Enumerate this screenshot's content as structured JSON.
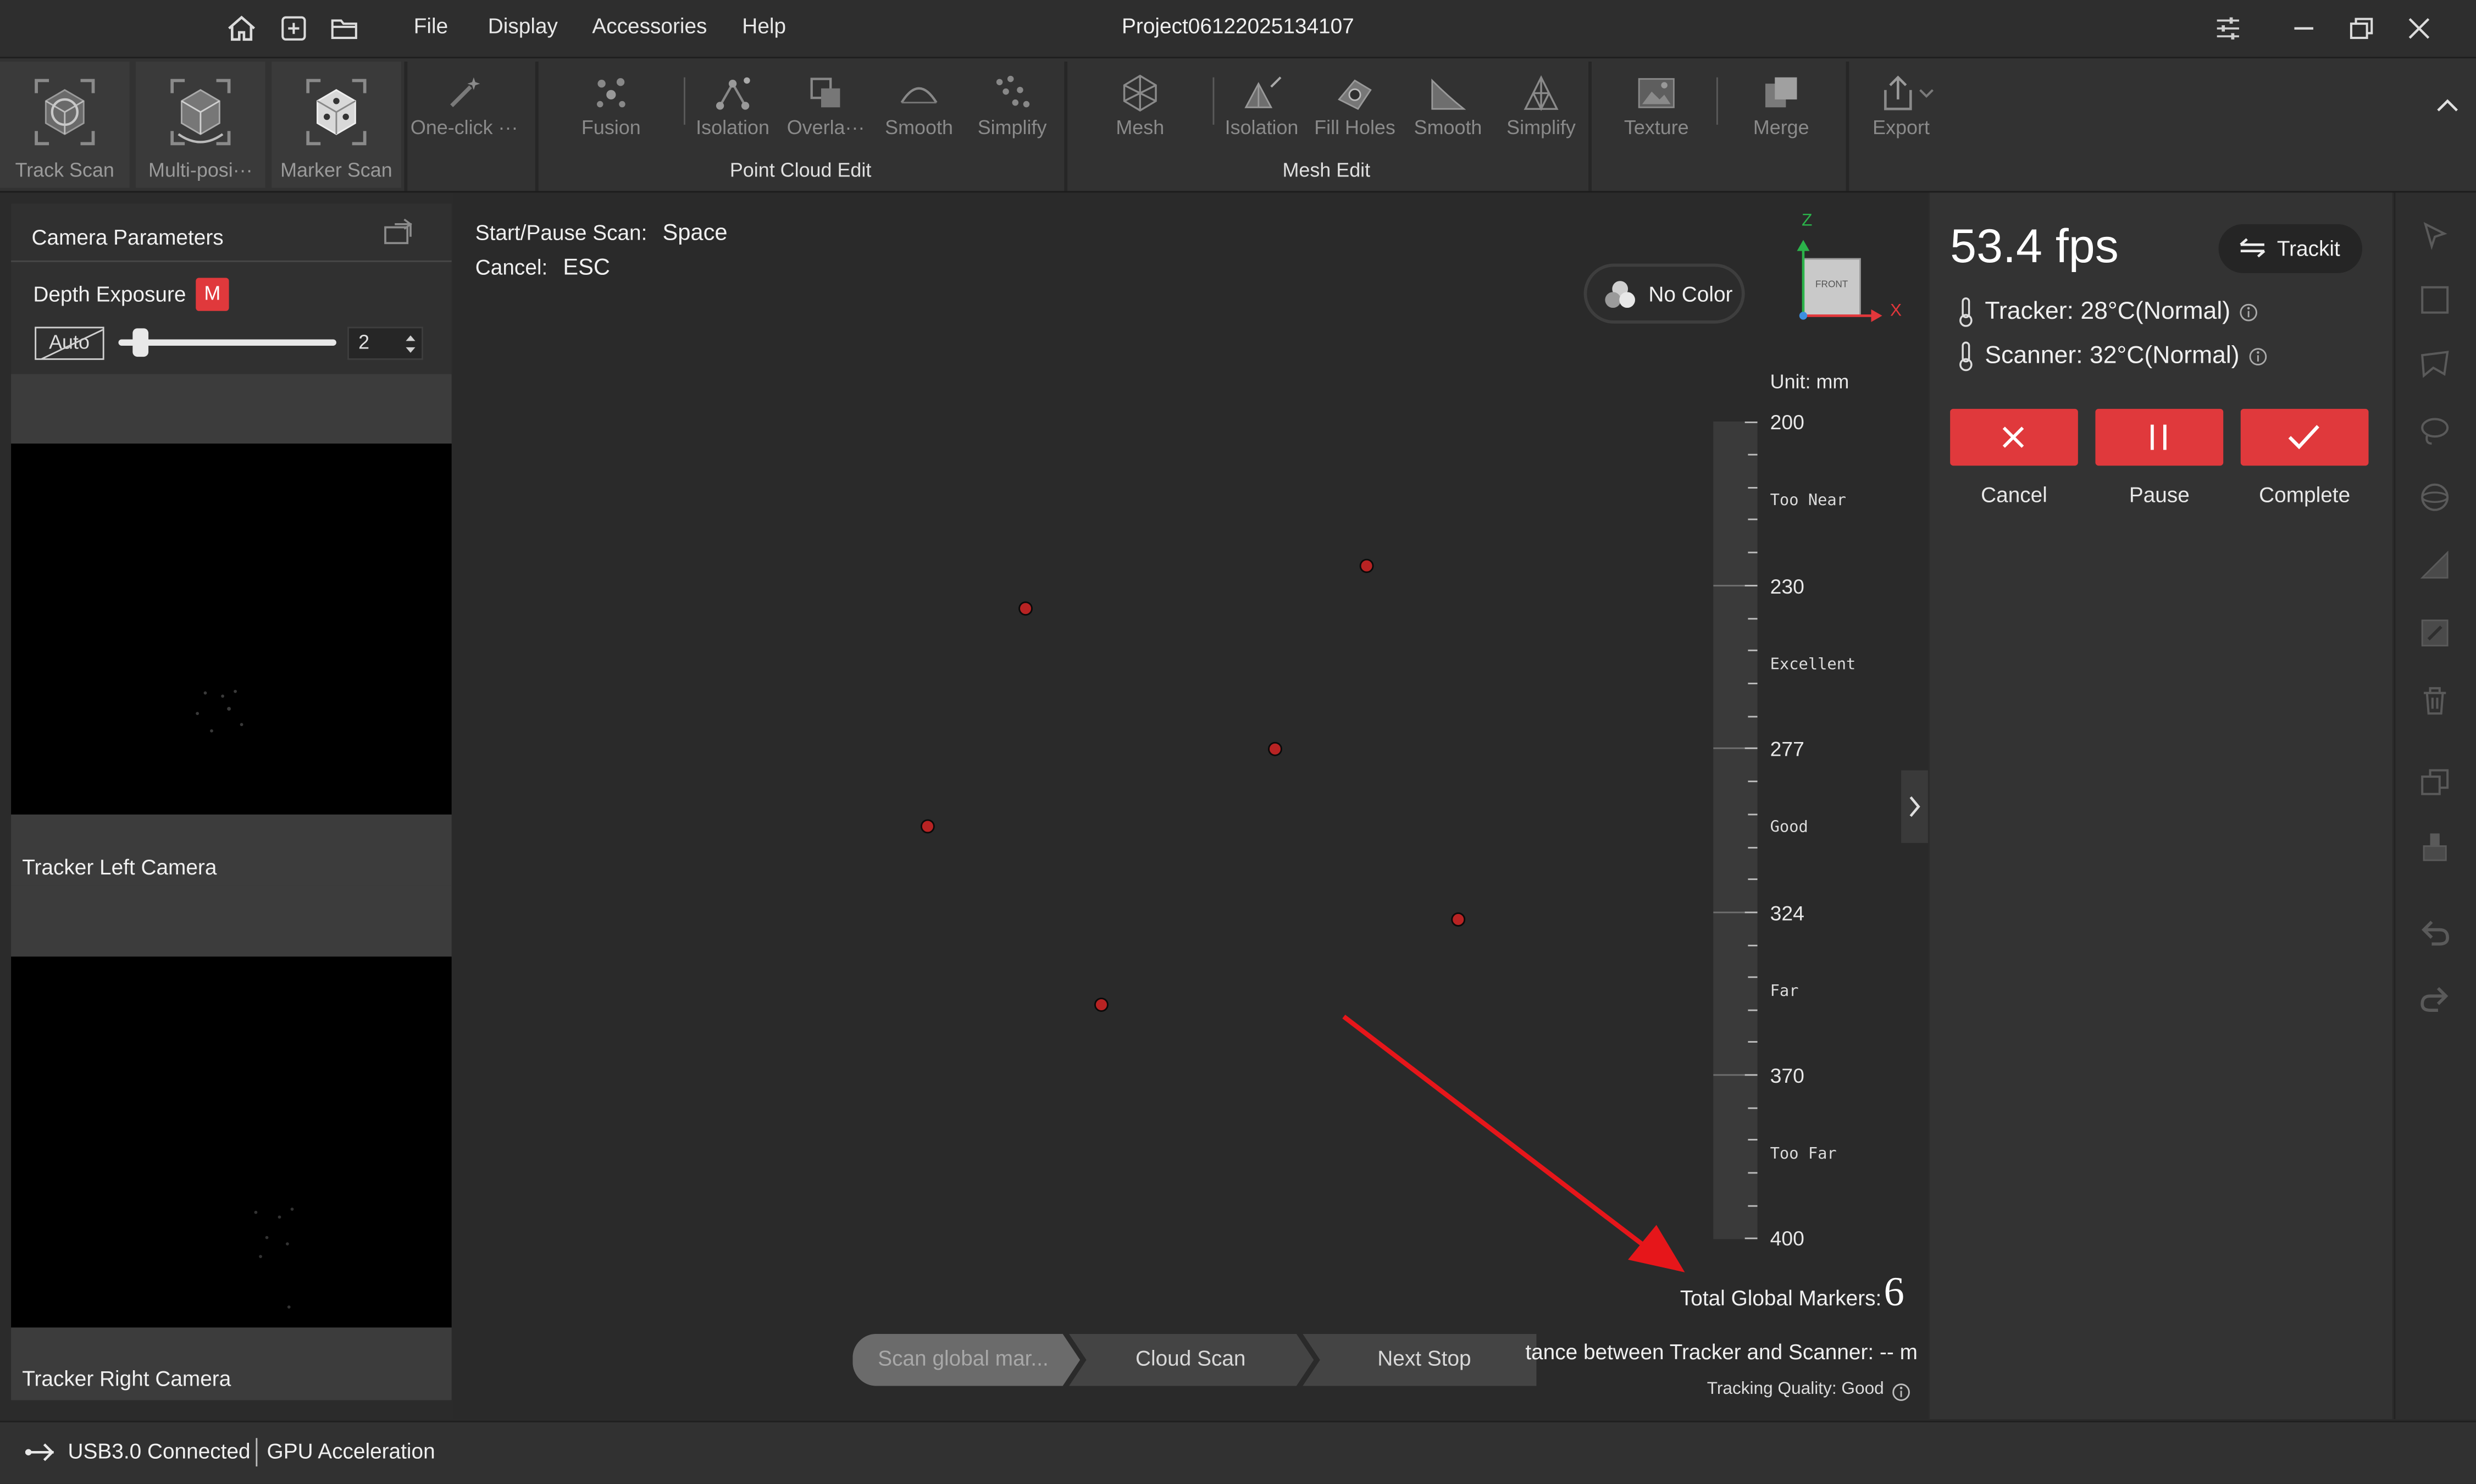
{
  "window": {
    "title": "Project06122025134107",
    "menu": [
      "File",
      "Display",
      "Accessories",
      "Help"
    ]
  },
  "toolbar": {
    "scan_modes": [
      {
        "label": "Track Scan",
        "icon": "track-scan-icon"
      },
      {
        "label": "Multi-posi···",
        "icon": "multi-position-icon"
      },
      {
        "label": "Marker Scan",
        "icon": "marker-scan-icon"
      }
    ],
    "one_click": {
      "label": "One-click ···",
      "icon": "magic-wand-icon"
    },
    "fusion": {
      "label": "Fusion",
      "icon": "fusion-icon"
    },
    "point_cloud_tools": [
      {
        "label": "Isolation",
        "icon": "isolation-icon"
      },
      {
        "label": "Overla···",
        "icon": "overlap-icon"
      },
      {
        "label": "Smooth",
        "icon": "smooth-icon"
      },
      {
        "label": "Simplify",
        "icon": "simplify-icon"
      }
    ],
    "point_cloud_group": "Point Cloud Edit",
    "mesh": {
      "label": "Mesh",
      "icon": "mesh-icon"
    },
    "mesh_tools": [
      {
        "label": "Isolation",
        "icon": "mesh-isolation-icon"
      },
      {
        "label": "Fill Holes",
        "icon": "fill-holes-icon"
      },
      {
        "label": "Smooth",
        "icon": "mesh-smooth-icon"
      },
      {
        "label": "Simplify",
        "icon": "mesh-simplify-icon"
      }
    ],
    "mesh_group": "Mesh Edit",
    "texture": {
      "label": "Texture",
      "icon": "texture-icon"
    },
    "merge": {
      "label": "Merge",
      "icon": "merge-icon"
    },
    "export": {
      "label": "Export",
      "icon": "export-icon"
    }
  },
  "left_panel": {
    "title": "Camera Parameters",
    "depth_exposure_label": "Depth Exposure",
    "mode_badge": "M",
    "auto_label": "Auto",
    "exposure_value": "2",
    "exposure_level": 0.1,
    "left_camera_label": "Tracker Left Camera",
    "right_camera_label": "Tracker Right Camera"
  },
  "viewport": {
    "shortcuts": [
      {
        "label": "Start/Pause Scan:",
        "key": "Space"
      },
      {
        "label": "Cancel:",
        "key": "ESC"
      }
    ],
    "color_mode": "No Color",
    "axes": {
      "z": "Z",
      "x": "X",
      "face": "FRONT"
    },
    "distance_scale": {
      "unit": "Unit: mm",
      "ticks": [
        "200",
        "230",
        "277",
        "324",
        "370",
        "400"
      ],
      "zones": [
        "Too Near",
        "Excellent",
        "Good",
        "Far",
        "Too Far"
      ]
    },
    "total_markers_label": "Total Global Markers:",
    "total_markers_value": "6",
    "distance_text": "tance between Tracker and Scanner: -- m",
    "tracking_quality": "Tracking Quality: Good",
    "workflow_steps": [
      "Scan global mar...",
      "Cloud Scan",
      "Next Stop"
    ]
  },
  "right_panel": {
    "fps": "53.4 fps",
    "device_button": "Trackit",
    "tracker_temp": "Tracker: 28°C(Normal)",
    "scanner_temp": "Scanner: 32°C(Normal)",
    "actions": [
      {
        "label": "Cancel",
        "icon": "x-icon"
      },
      {
        "label": "Pause",
        "icon": "pause-icon"
      },
      {
        "label": "Complete",
        "icon": "check-icon"
      }
    ],
    "accent_color": "#e0393c"
  },
  "status_bar": {
    "connection": "USB3.0 Connected",
    "gpu": "GPU Acceleration"
  }
}
